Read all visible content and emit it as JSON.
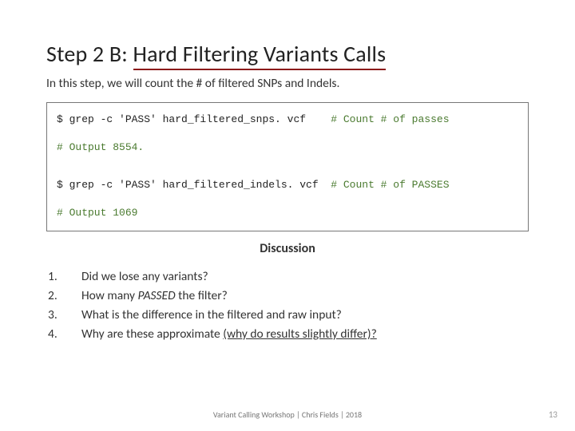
{
  "title_prefix": "Step 2 B: ",
  "title_underlined": "Hard Filtering Variants Calls",
  "subtitle": "In this step, we will count the # of filtered SNPs and Indels.",
  "code": {
    "line1_cmd": "$ grep -c 'PASS' hard_filtered_snps. vcf    ",
    "line1_comment": "# Count # of passes",
    "line2": "# Output 8554.",
    "line3_cmd": "$ grep -c 'PASS' hard_filtered_indels. vcf  ",
    "line3_comment": "# Count # of PASSES",
    "line4": "# Output 1069"
  },
  "discussion_header": "Discussion",
  "qnums": [
    "1.",
    "2.",
    "3.",
    "4."
  ],
  "q1": "Did we lose any variants?",
  "q2a": "How many ",
  "q2b": "PASSED",
  "q2c": " the filter?",
  "q3": "What is the difference in the filtered and raw input?",
  "q4a": "Why are these approximate ",
  "q4b": "(why do results slightly differ)?",
  "footer": "Variant Calling Workshop | Chris Fields | 2018",
  "pagenum": "13"
}
